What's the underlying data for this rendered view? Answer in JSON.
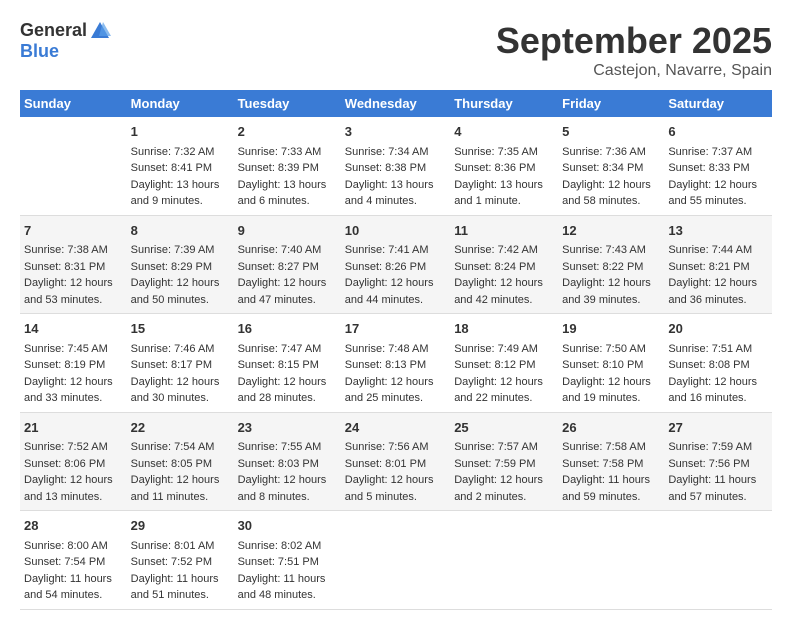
{
  "logo": {
    "general": "General",
    "blue": "Blue"
  },
  "title": "September 2025",
  "location": "Castejon, Navarre, Spain",
  "headers": [
    "Sunday",
    "Monday",
    "Tuesday",
    "Wednesday",
    "Thursday",
    "Friday",
    "Saturday"
  ],
  "weeks": [
    [
      {
        "day": "",
        "sunrise": "",
        "sunset": "",
        "daylight": ""
      },
      {
        "day": "1",
        "sunrise": "Sunrise: 7:32 AM",
        "sunset": "Sunset: 8:41 PM",
        "daylight": "Daylight: 13 hours and 9 minutes."
      },
      {
        "day": "2",
        "sunrise": "Sunrise: 7:33 AM",
        "sunset": "Sunset: 8:39 PM",
        "daylight": "Daylight: 13 hours and 6 minutes."
      },
      {
        "day": "3",
        "sunrise": "Sunrise: 7:34 AM",
        "sunset": "Sunset: 8:38 PM",
        "daylight": "Daylight: 13 hours and 4 minutes."
      },
      {
        "day": "4",
        "sunrise": "Sunrise: 7:35 AM",
        "sunset": "Sunset: 8:36 PM",
        "daylight": "Daylight: 13 hours and 1 minute."
      },
      {
        "day": "5",
        "sunrise": "Sunrise: 7:36 AM",
        "sunset": "Sunset: 8:34 PM",
        "daylight": "Daylight: 12 hours and 58 minutes."
      },
      {
        "day": "6",
        "sunrise": "Sunrise: 7:37 AM",
        "sunset": "Sunset: 8:33 PM",
        "daylight": "Daylight: 12 hours and 55 minutes."
      }
    ],
    [
      {
        "day": "7",
        "sunrise": "Sunrise: 7:38 AM",
        "sunset": "Sunset: 8:31 PM",
        "daylight": "Daylight: 12 hours and 53 minutes."
      },
      {
        "day": "8",
        "sunrise": "Sunrise: 7:39 AM",
        "sunset": "Sunset: 8:29 PM",
        "daylight": "Daylight: 12 hours and 50 minutes."
      },
      {
        "day": "9",
        "sunrise": "Sunrise: 7:40 AM",
        "sunset": "Sunset: 8:27 PM",
        "daylight": "Daylight: 12 hours and 47 minutes."
      },
      {
        "day": "10",
        "sunrise": "Sunrise: 7:41 AM",
        "sunset": "Sunset: 8:26 PM",
        "daylight": "Daylight: 12 hours and 44 minutes."
      },
      {
        "day": "11",
        "sunrise": "Sunrise: 7:42 AM",
        "sunset": "Sunset: 8:24 PM",
        "daylight": "Daylight: 12 hours and 42 minutes."
      },
      {
        "day": "12",
        "sunrise": "Sunrise: 7:43 AM",
        "sunset": "Sunset: 8:22 PM",
        "daylight": "Daylight: 12 hours and 39 minutes."
      },
      {
        "day": "13",
        "sunrise": "Sunrise: 7:44 AM",
        "sunset": "Sunset: 8:21 PM",
        "daylight": "Daylight: 12 hours and 36 minutes."
      }
    ],
    [
      {
        "day": "14",
        "sunrise": "Sunrise: 7:45 AM",
        "sunset": "Sunset: 8:19 PM",
        "daylight": "Daylight: 12 hours and 33 minutes."
      },
      {
        "day": "15",
        "sunrise": "Sunrise: 7:46 AM",
        "sunset": "Sunset: 8:17 PM",
        "daylight": "Daylight: 12 hours and 30 minutes."
      },
      {
        "day": "16",
        "sunrise": "Sunrise: 7:47 AM",
        "sunset": "Sunset: 8:15 PM",
        "daylight": "Daylight: 12 hours and 28 minutes."
      },
      {
        "day": "17",
        "sunrise": "Sunrise: 7:48 AM",
        "sunset": "Sunset: 8:13 PM",
        "daylight": "Daylight: 12 hours and 25 minutes."
      },
      {
        "day": "18",
        "sunrise": "Sunrise: 7:49 AM",
        "sunset": "Sunset: 8:12 PM",
        "daylight": "Daylight: 12 hours and 22 minutes."
      },
      {
        "day": "19",
        "sunrise": "Sunrise: 7:50 AM",
        "sunset": "Sunset: 8:10 PM",
        "daylight": "Daylight: 12 hours and 19 minutes."
      },
      {
        "day": "20",
        "sunrise": "Sunrise: 7:51 AM",
        "sunset": "Sunset: 8:08 PM",
        "daylight": "Daylight: 12 hours and 16 minutes."
      }
    ],
    [
      {
        "day": "21",
        "sunrise": "Sunrise: 7:52 AM",
        "sunset": "Sunset: 8:06 PM",
        "daylight": "Daylight: 12 hours and 13 minutes."
      },
      {
        "day": "22",
        "sunrise": "Sunrise: 7:54 AM",
        "sunset": "Sunset: 8:05 PM",
        "daylight": "Daylight: 12 hours and 11 minutes."
      },
      {
        "day": "23",
        "sunrise": "Sunrise: 7:55 AM",
        "sunset": "Sunset: 8:03 PM",
        "daylight": "Daylight: 12 hours and 8 minutes."
      },
      {
        "day": "24",
        "sunrise": "Sunrise: 7:56 AM",
        "sunset": "Sunset: 8:01 PM",
        "daylight": "Daylight: 12 hours and 5 minutes."
      },
      {
        "day": "25",
        "sunrise": "Sunrise: 7:57 AM",
        "sunset": "Sunset: 7:59 PM",
        "daylight": "Daylight: 12 hours and 2 minutes."
      },
      {
        "day": "26",
        "sunrise": "Sunrise: 7:58 AM",
        "sunset": "Sunset: 7:58 PM",
        "daylight": "Daylight: 11 hours and 59 minutes."
      },
      {
        "day": "27",
        "sunrise": "Sunrise: 7:59 AM",
        "sunset": "Sunset: 7:56 PM",
        "daylight": "Daylight: 11 hours and 57 minutes."
      }
    ],
    [
      {
        "day": "28",
        "sunrise": "Sunrise: 8:00 AM",
        "sunset": "Sunset: 7:54 PM",
        "daylight": "Daylight: 11 hours and 54 minutes."
      },
      {
        "day": "29",
        "sunrise": "Sunrise: 8:01 AM",
        "sunset": "Sunset: 7:52 PM",
        "daylight": "Daylight: 11 hours and 51 minutes."
      },
      {
        "day": "30",
        "sunrise": "Sunrise: 8:02 AM",
        "sunset": "Sunset: 7:51 PM",
        "daylight": "Daylight: 11 hours and 48 minutes."
      },
      {
        "day": "",
        "sunrise": "",
        "sunset": "",
        "daylight": ""
      },
      {
        "day": "",
        "sunrise": "",
        "sunset": "",
        "daylight": ""
      },
      {
        "day": "",
        "sunrise": "",
        "sunset": "",
        "daylight": ""
      },
      {
        "day": "",
        "sunrise": "",
        "sunset": "",
        "daylight": ""
      }
    ]
  ]
}
